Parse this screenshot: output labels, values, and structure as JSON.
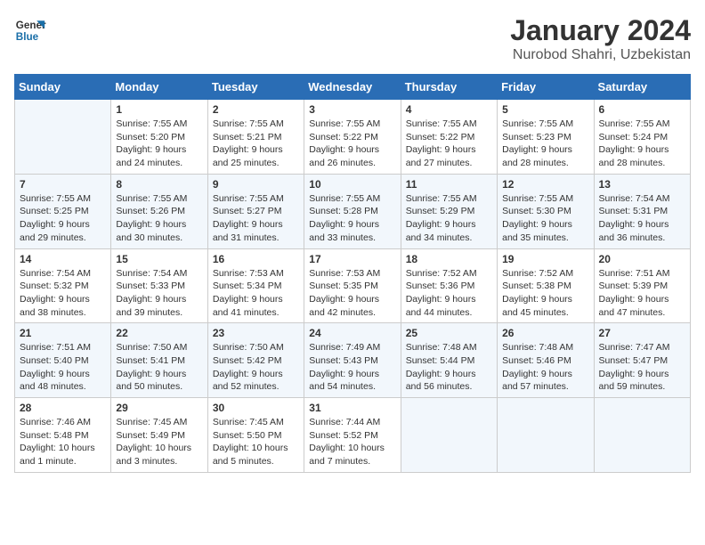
{
  "logo": {
    "line1": "General",
    "line2": "Blue"
  },
  "title": "January 2024",
  "subtitle": "Nurobod Shahri, Uzbekistan",
  "header": {
    "accent_color": "#2a6db5"
  },
  "days_of_week": [
    "Sunday",
    "Monday",
    "Tuesday",
    "Wednesday",
    "Thursday",
    "Friday",
    "Saturday"
  ],
  "weeks": [
    [
      {
        "day": "",
        "sunrise": "",
        "sunset": "",
        "daylight": ""
      },
      {
        "day": "1",
        "sunrise": "Sunrise: 7:55 AM",
        "sunset": "Sunset: 5:20 PM",
        "daylight": "Daylight: 9 hours and 24 minutes."
      },
      {
        "day": "2",
        "sunrise": "Sunrise: 7:55 AM",
        "sunset": "Sunset: 5:21 PM",
        "daylight": "Daylight: 9 hours and 25 minutes."
      },
      {
        "day": "3",
        "sunrise": "Sunrise: 7:55 AM",
        "sunset": "Sunset: 5:22 PM",
        "daylight": "Daylight: 9 hours and 26 minutes."
      },
      {
        "day": "4",
        "sunrise": "Sunrise: 7:55 AM",
        "sunset": "Sunset: 5:22 PM",
        "daylight": "Daylight: 9 hours and 27 minutes."
      },
      {
        "day": "5",
        "sunrise": "Sunrise: 7:55 AM",
        "sunset": "Sunset: 5:23 PM",
        "daylight": "Daylight: 9 hours and 28 minutes."
      },
      {
        "day": "6",
        "sunrise": "Sunrise: 7:55 AM",
        "sunset": "Sunset: 5:24 PM",
        "daylight": "Daylight: 9 hours and 28 minutes."
      }
    ],
    [
      {
        "day": "7",
        "sunrise": "Sunrise: 7:55 AM",
        "sunset": "Sunset: 5:25 PM",
        "daylight": "Daylight: 9 hours and 29 minutes."
      },
      {
        "day": "8",
        "sunrise": "Sunrise: 7:55 AM",
        "sunset": "Sunset: 5:26 PM",
        "daylight": "Daylight: 9 hours and 30 minutes."
      },
      {
        "day": "9",
        "sunrise": "Sunrise: 7:55 AM",
        "sunset": "Sunset: 5:27 PM",
        "daylight": "Daylight: 9 hours and 31 minutes."
      },
      {
        "day": "10",
        "sunrise": "Sunrise: 7:55 AM",
        "sunset": "Sunset: 5:28 PM",
        "daylight": "Daylight: 9 hours and 33 minutes."
      },
      {
        "day": "11",
        "sunrise": "Sunrise: 7:55 AM",
        "sunset": "Sunset: 5:29 PM",
        "daylight": "Daylight: 9 hours and 34 minutes."
      },
      {
        "day": "12",
        "sunrise": "Sunrise: 7:55 AM",
        "sunset": "Sunset: 5:30 PM",
        "daylight": "Daylight: 9 hours and 35 minutes."
      },
      {
        "day": "13",
        "sunrise": "Sunrise: 7:54 AM",
        "sunset": "Sunset: 5:31 PM",
        "daylight": "Daylight: 9 hours and 36 minutes."
      }
    ],
    [
      {
        "day": "14",
        "sunrise": "Sunrise: 7:54 AM",
        "sunset": "Sunset: 5:32 PM",
        "daylight": "Daylight: 9 hours and 38 minutes."
      },
      {
        "day": "15",
        "sunrise": "Sunrise: 7:54 AM",
        "sunset": "Sunset: 5:33 PM",
        "daylight": "Daylight: 9 hours and 39 minutes."
      },
      {
        "day": "16",
        "sunrise": "Sunrise: 7:53 AM",
        "sunset": "Sunset: 5:34 PM",
        "daylight": "Daylight: 9 hours and 41 minutes."
      },
      {
        "day": "17",
        "sunrise": "Sunrise: 7:53 AM",
        "sunset": "Sunset: 5:35 PM",
        "daylight": "Daylight: 9 hours and 42 minutes."
      },
      {
        "day": "18",
        "sunrise": "Sunrise: 7:52 AM",
        "sunset": "Sunset: 5:36 PM",
        "daylight": "Daylight: 9 hours and 44 minutes."
      },
      {
        "day": "19",
        "sunrise": "Sunrise: 7:52 AM",
        "sunset": "Sunset: 5:38 PM",
        "daylight": "Daylight: 9 hours and 45 minutes."
      },
      {
        "day": "20",
        "sunrise": "Sunrise: 7:51 AM",
        "sunset": "Sunset: 5:39 PM",
        "daylight": "Daylight: 9 hours and 47 minutes."
      }
    ],
    [
      {
        "day": "21",
        "sunrise": "Sunrise: 7:51 AM",
        "sunset": "Sunset: 5:40 PM",
        "daylight": "Daylight: 9 hours and 48 minutes."
      },
      {
        "day": "22",
        "sunrise": "Sunrise: 7:50 AM",
        "sunset": "Sunset: 5:41 PM",
        "daylight": "Daylight: 9 hours and 50 minutes."
      },
      {
        "day": "23",
        "sunrise": "Sunrise: 7:50 AM",
        "sunset": "Sunset: 5:42 PM",
        "daylight": "Daylight: 9 hours and 52 minutes."
      },
      {
        "day": "24",
        "sunrise": "Sunrise: 7:49 AM",
        "sunset": "Sunset: 5:43 PM",
        "daylight": "Daylight: 9 hours and 54 minutes."
      },
      {
        "day": "25",
        "sunrise": "Sunrise: 7:48 AM",
        "sunset": "Sunset: 5:44 PM",
        "daylight": "Daylight: 9 hours and 56 minutes."
      },
      {
        "day": "26",
        "sunrise": "Sunrise: 7:48 AM",
        "sunset": "Sunset: 5:46 PM",
        "daylight": "Daylight: 9 hours and 57 minutes."
      },
      {
        "day": "27",
        "sunrise": "Sunrise: 7:47 AM",
        "sunset": "Sunset: 5:47 PM",
        "daylight": "Daylight: 9 hours and 59 minutes."
      }
    ],
    [
      {
        "day": "28",
        "sunrise": "Sunrise: 7:46 AM",
        "sunset": "Sunset: 5:48 PM",
        "daylight": "Daylight: 10 hours and 1 minute."
      },
      {
        "day": "29",
        "sunrise": "Sunrise: 7:45 AM",
        "sunset": "Sunset: 5:49 PM",
        "daylight": "Daylight: 10 hours and 3 minutes."
      },
      {
        "day": "30",
        "sunrise": "Sunrise: 7:45 AM",
        "sunset": "Sunset: 5:50 PM",
        "daylight": "Daylight: 10 hours and 5 minutes."
      },
      {
        "day": "31",
        "sunrise": "Sunrise: 7:44 AM",
        "sunset": "Sunset: 5:52 PM",
        "daylight": "Daylight: 10 hours and 7 minutes."
      },
      {
        "day": "",
        "sunrise": "",
        "sunset": "",
        "daylight": ""
      },
      {
        "day": "",
        "sunrise": "",
        "sunset": "",
        "daylight": ""
      },
      {
        "day": "",
        "sunrise": "",
        "sunset": "",
        "daylight": ""
      }
    ]
  ]
}
